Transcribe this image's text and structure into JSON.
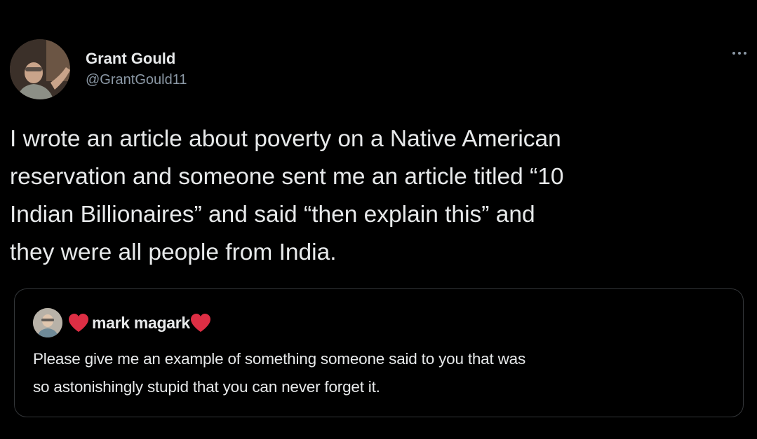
{
  "tweet": {
    "author": {
      "display_name": "Grant Gould",
      "handle": "@GrantGould11",
      "avatar_icon": "user-avatar-photo"
    },
    "more_icon": "more-horizontal-icon",
    "text_lines": [
      "I wrote an article about poverty on a Native American",
      "reservation and someone sent me an article titled “10",
      "Indian Billionaires” and said “then explain this” and",
      "they were all people from India."
    ]
  },
  "quoted_tweet": {
    "author": {
      "display_name": "mark magark",
      "avatar_icon": "user-avatar-photo",
      "decoration_icon": "red-heart-icon",
      "heart_color": "#dd2e44"
    },
    "text_lines": [
      "Please give me an example of something someone said to you that was",
      "so astonishingly stupid that you can never forget it."
    ]
  },
  "colors": {
    "background": "#000000",
    "primary_text": "#e7e9ea",
    "secondary_text": "#8b98a5",
    "border": "#333639"
  }
}
